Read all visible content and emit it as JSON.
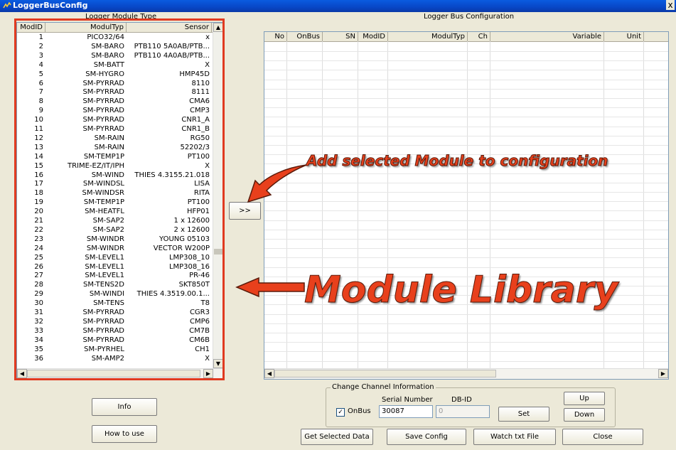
{
  "window": {
    "title": "LoggerBusConfig",
    "close_glyph": "x"
  },
  "left_panel": {
    "title": "Logger Module Type",
    "columns": [
      "ModID",
      "ModulTyp",
      "Sensor"
    ],
    "rows": [
      [
        "1",
        "PICO32/64",
        "x"
      ],
      [
        "2",
        "SM-BARO",
        "PTB110 5A0AB/PTB..."
      ],
      [
        "3",
        "SM-BARO",
        "PTB110 4A0AB/PTB..."
      ],
      [
        "4",
        "SM-BATT",
        "X"
      ],
      [
        "5",
        "SM-HYGRO",
        "HMP45D"
      ],
      [
        "6",
        "SM-PYRRAD",
        "8110"
      ],
      [
        "7",
        "SM-PYRRAD",
        "8111"
      ],
      [
        "8",
        "SM-PYRRAD",
        "CMA6"
      ],
      [
        "9",
        "SM-PYRRAD",
        "CMP3"
      ],
      [
        "10",
        "SM-PYRRAD",
        "CNR1_A"
      ],
      [
        "11",
        "SM-PYRRAD",
        "CNR1_B"
      ],
      [
        "12",
        "SM-RAIN",
        "RG50"
      ],
      [
        "13",
        "SM-RAIN",
        "52202/3"
      ],
      [
        "14",
        "SM-TEMP1P",
        "PT100"
      ],
      [
        "15",
        "TRIME-EZ/IT/IPH",
        "X"
      ],
      [
        "16",
        "SM-WIND",
        "THIES 4.3155.21.018"
      ],
      [
        "17",
        "SM-WINDSL",
        "LISA"
      ],
      [
        "18",
        "SM-WINDSR",
        "RITA"
      ],
      [
        "19",
        "SM-TEMP1P",
        "PT100"
      ],
      [
        "20",
        "SM-HEATFL",
        "HFP01"
      ],
      [
        "21",
        "SM-SAP2",
        "1 x 12600"
      ],
      [
        "22",
        "SM-SAP2",
        "2 x 12600"
      ],
      [
        "23",
        "SM-WINDR",
        "YOUNG 05103"
      ],
      [
        "24",
        "SM-WINDR",
        "VECTOR W200P"
      ],
      [
        "25",
        "SM-LEVEL1",
        "LMP308_10"
      ],
      [
        "26",
        "SM-LEVEL1",
        "LMP308_16"
      ],
      [
        "27",
        "SM-LEVEL1",
        "PR-46"
      ],
      [
        "28",
        "SM-TENS2D",
        "SKT850T"
      ],
      [
        "29",
        "SM-WINDI",
        "THIES 4.3519.00.1..."
      ],
      [
        "30",
        "SM-TENS",
        "T8"
      ],
      [
        "31",
        "SM-PYRRAD",
        "CGR3"
      ],
      [
        "32",
        "SM-PYRRAD",
        "CMP6"
      ],
      [
        "33",
        "SM-PYRRAD",
        "CM7B"
      ],
      [
        "34",
        "SM-PYRRAD",
        "CM6B"
      ],
      [
        "35",
        "SM-PYRHEL",
        "CH1"
      ],
      [
        "36",
        "SM-AMP2",
        "X"
      ]
    ]
  },
  "right_panel": {
    "title": "Logger Bus Configuration",
    "columns": [
      "No",
      "OnBus",
      "SN",
      "ModID",
      "ModulTyp",
      "Ch",
      "Variable",
      "Unit"
    ]
  },
  "add_button_label": ">>",
  "annotations": {
    "add": "Add selected Module to configuration",
    "library": "Module Library"
  },
  "channel_info": {
    "group_label": "Change Channel Information",
    "serial_label": "Serial Number",
    "dbid_label": "DB-ID",
    "onbus_label": "OnBus",
    "onbus_checked": true,
    "serial_value": "30087",
    "dbid_value": "0",
    "set_label": "Set",
    "up_label": "Up",
    "down_label": "Down"
  },
  "buttons": {
    "info": "Info",
    "howto": "How to use",
    "get_selected": "Get Selected Data",
    "save_config": "Save Config",
    "watch_txt": "Watch txt File",
    "close": "Close"
  },
  "scroll": {
    "up": "▲",
    "down": "▼",
    "left": "◀",
    "right": "▶"
  }
}
